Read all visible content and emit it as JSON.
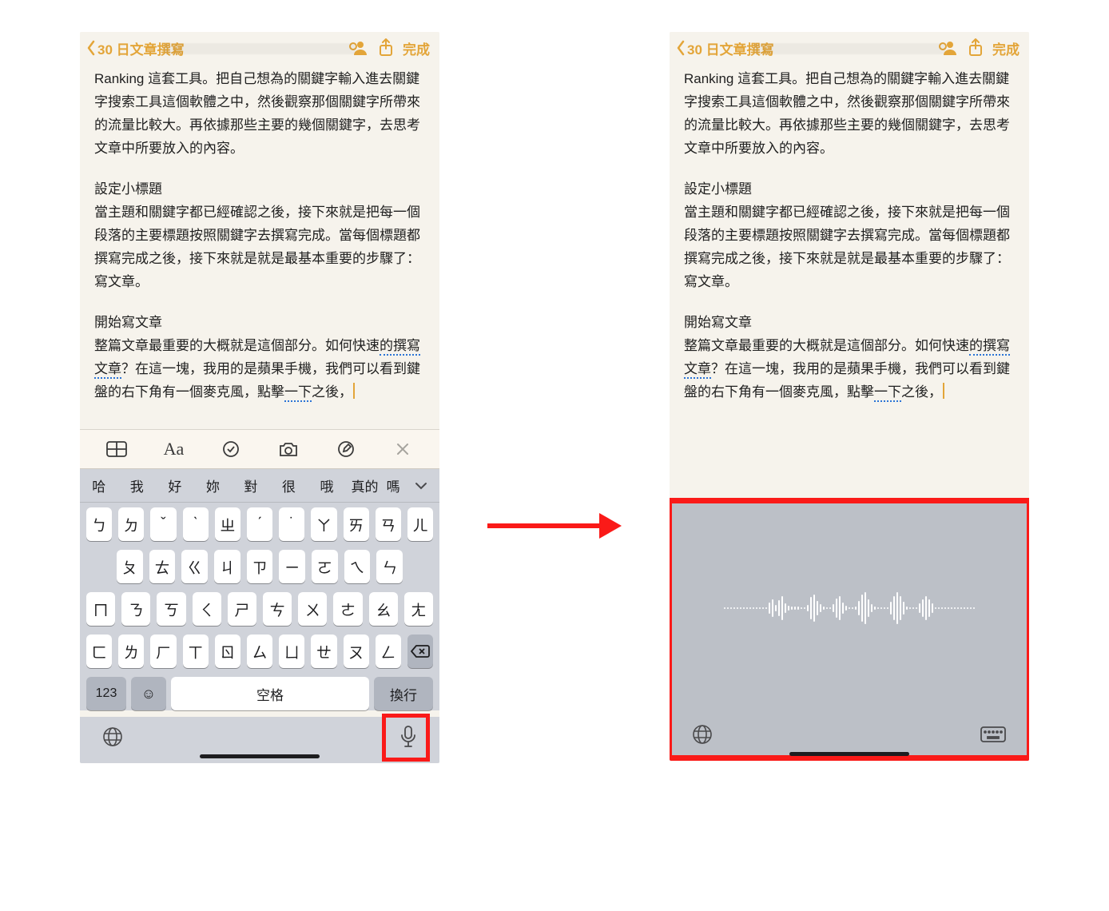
{
  "nav": {
    "back_label": "30 日文章撰寫",
    "done_label": "完成"
  },
  "note": {
    "para1": "Ranking 這套工具。把自己想為的關鍵字輸入進去關鍵字搜索工具這個軟體之中，然後觀察那個關鍵字所帶來的流量比較大。再依據那些主要的幾個關鍵字，去思考文章中所要放入的內容。",
    "head2": "設定小標題",
    "para2": "當主題和關鍵字都已經確認之後，接下來就是把每一個段落的主要標題按照關鍵字去撰寫完成。當每個標題都撰寫完成之後，接下來就是就是最基本重要的步驟了：寫文章。",
    "head3": "開始寫文章",
    "para3a": "整篇文章最重要的大概就是這個部分。如何快速",
    "para3_u1": "的撰寫文章",
    "para3b": "？在這一塊，我用的是蘋果手機，我們可以看到鍵盤的右下角有一個麥克風，點擊",
    "para3_u2": "一下",
    "para3c": "之後，"
  },
  "sugg": [
    "哈",
    "我",
    "好",
    "妳",
    "對",
    "很",
    "哦",
    "真的",
    "嗎"
  ],
  "kbd_rows": [
    [
      "ㄅ",
      "ㄉ",
      "ˇ",
      "ˋ",
      "ㄓ",
      "ˊ",
      "˙",
      "ㄚ",
      "ㄞ",
      "ㄢ",
      "ㄦ"
    ],
    [
      "ㄆ",
      "ㄊ",
      "ㄍ",
      "ㄐ",
      "ㄗ",
      "ㄧ",
      "ㄛ",
      "ㄟ",
      "ㄣ"
    ],
    [
      "ㄇ",
      "ㄋ",
      "ㄎ",
      "ㄑ",
      "ㄕ",
      "ㄘ",
      "ㄨ",
      "ㄜ",
      "ㄠ",
      "ㄤ"
    ],
    [
      "ㄈ",
      "ㄌ",
      "ㄏ",
      "ㄒ",
      "ㄖ",
      "ㄙ",
      "ㄩ",
      "ㄝ",
      "ㄡ",
      "ㄥ"
    ]
  ],
  "kbd_bottom": {
    "num": "123",
    "space": "空格",
    "enter": "換行"
  },
  "tools": {
    "aa": "Aa"
  }
}
